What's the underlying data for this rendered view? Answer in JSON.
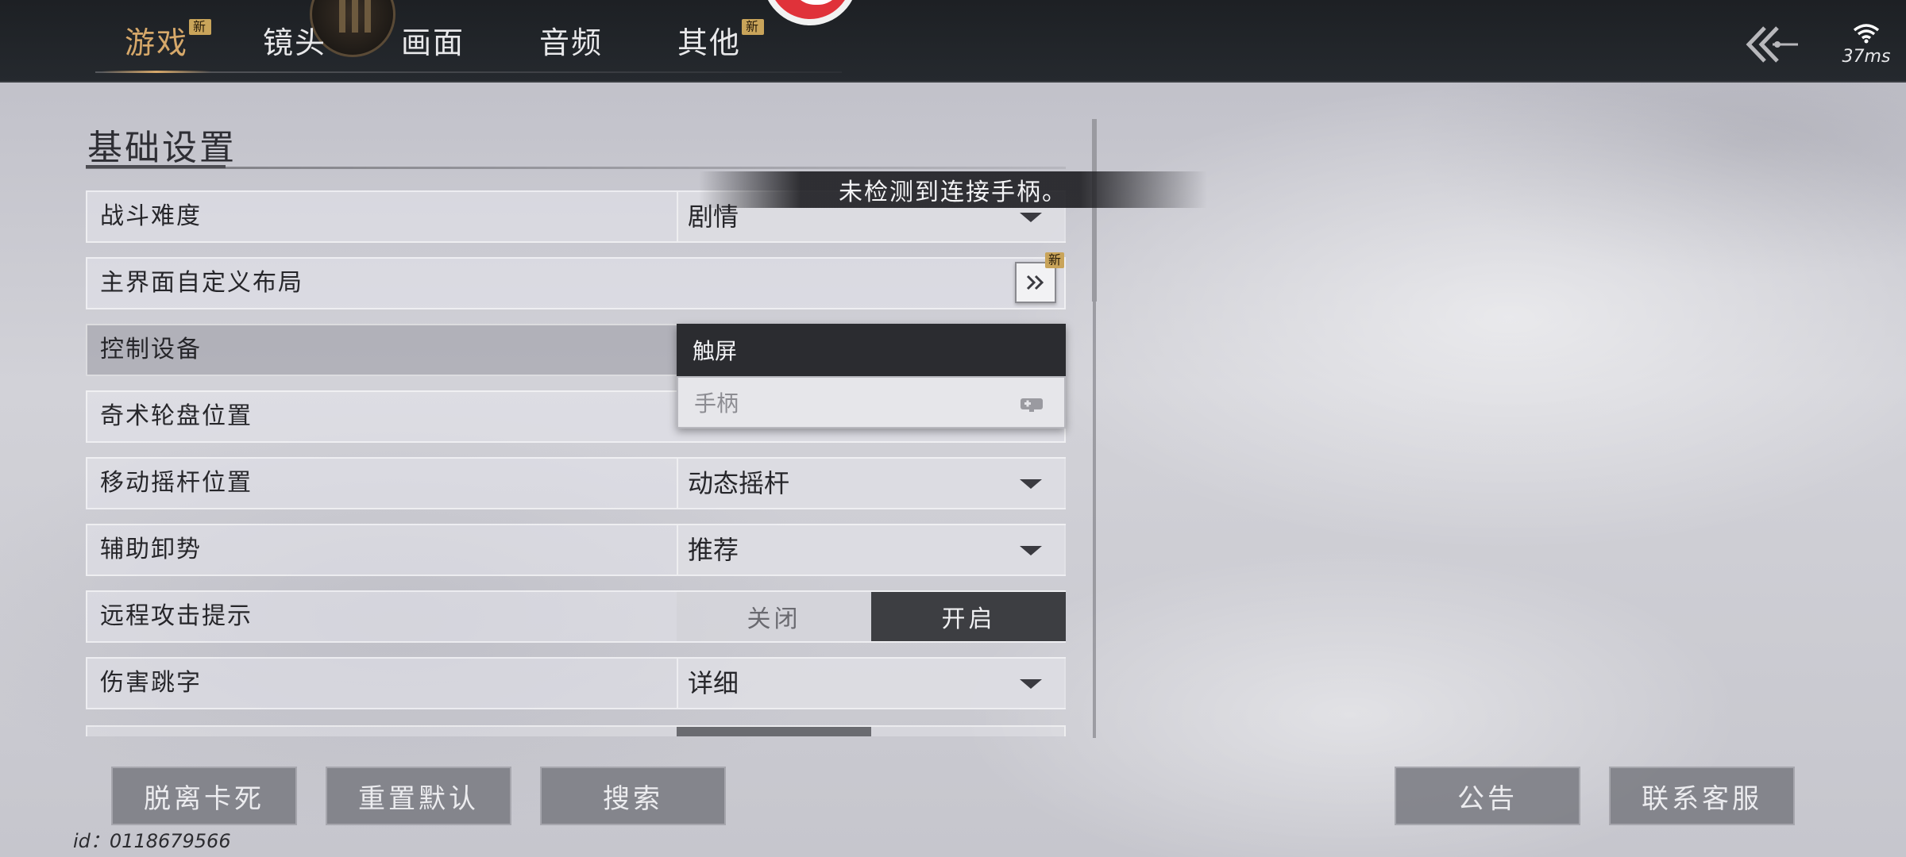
{
  "tabs": [
    {
      "label": "游戏",
      "badge": "新",
      "active": true
    },
    {
      "label": "镜头",
      "badge": ""
    },
    {
      "label": "画面",
      "badge": ""
    },
    {
      "label": "音频",
      "badge": ""
    },
    {
      "label": "其他",
      "badge": "新"
    }
  ],
  "status": {
    "ping": "37ms"
  },
  "section": {
    "title": "基础设置"
  },
  "toast": "未检测到连接手柄。",
  "rows": {
    "difficulty": {
      "label": "战斗难度",
      "value": "剧情"
    },
    "layout": {
      "label": "主界面自定义布局",
      "badge": "新"
    },
    "control": {
      "label": "控制设备"
    },
    "wheel": {
      "label": "奇术轮盘位置"
    },
    "joystick": {
      "label": "移动摇杆位置",
      "value": "动态摇杆"
    },
    "assist": {
      "label": "辅助卸势",
      "value": "推荐"
    },
    "ranged": {
      "label": "远程攻击提示",
      "off": "关闭",
      "on": "开启"
    },
    "damage": {
      "label": "伤害跳字",
      "value": "详细"
    }
  },
  "dropdown": {
    "options": [
      {
        "label": "触屏",
        "selected": true
      },
      {
        "label": "手柄",
        "disabled": true
      }
    ]
  },
  "buttons": {
    "unstuck": "脱离卡死",
    "reset": "重置默认",
    "search": "搜索",
    "notice": "公告",
    "support": "联系客服"
  },
  "footer": {
    "user_id": "id：0118679566"
  },
  "colors": {
    "accent": "#d6a86a",
    "badge": "#c9a45a",
    "topbar": "#1d2024",
    "toggle_on": "#3d3e42"
  },
  "icons": [
    "back-arrow-icon",
    "wifi-icon",
    "double-chevron-right-icon",
    "gamepad-icon",
    "chevron-down-icon"
  ]
}
